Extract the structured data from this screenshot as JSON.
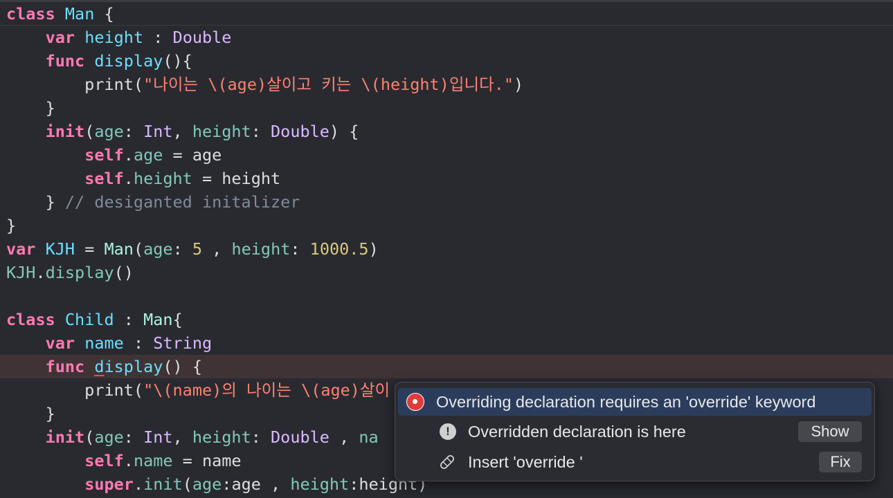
{
  "editor": {
    "comment_initializer": "// desiganted initalizer",
    "string_display_1": "\"나이는 \\(age)살이고 키는 \\(height)입니다.\"",
    "string_display_2_prefix": "\"\\(name)의 나이는 \\(age)살이",
    "values": {
      "age": "5",
      "height": "1000.5"
    }
  },
  "popup": {
    "error_message": "Overriding declaration requires an 'override' keyword",
    "note_message": "Overridden declaration is here",
    "fixit_message": "Insert 'override '",
    "show_label": "Show",
    "fix_label": "Fix",
    "icons": {
      "error": "error-icon",
      "note": "note-icon",
      "fixit": "bandage-icon"
    },
    "colors": {
      "error": "#e23b3b",
      "selected_row": "#2c3d5c"
    }
  }
}
